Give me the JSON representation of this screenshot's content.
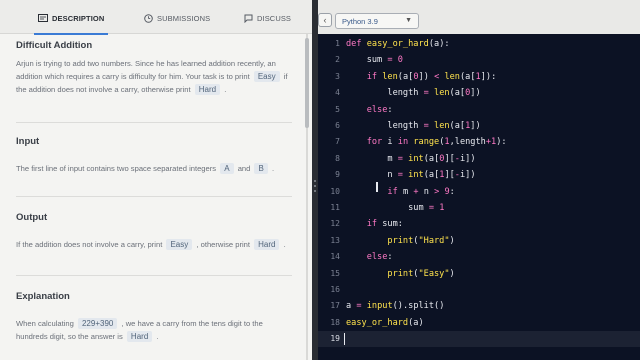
{
  "tabs": {
    "description": "DESCRIPTION",
    "submissions": "SUBMISSIONS",
    "discuss": "DISCUSS"
  },
  "language": {
    "selected": "Python 3.9"
  },
  "problem": {
    "title": "Difficult Addition",
    "intro_1": "Arjun is trying to add two numbers. Since he has learned addition recently, an addition which requires a carry is difficulty for him. Your task is to print",
    "intro_easy": "Easy",
    "intro_2": "if the addition does not involve a carry, otherwise print",
    "intro_hard": "Hard",
    "intro_end": ".",
    "input_title": "Input",
    "input_1": "The first line of input contains two space separated integers",
    "input_a": "A",
    "input_and": "and",
    "input_b": "B",
    "input_end": ".",
    "output_title": "Output",
    "output_1": "If the addition does not involve a carry, print",
    "output_easy": "Easy",
    "output_2": ", otherwise print",
    "output_hard": "Hard",
    "output_end": ".",
    "explanation_title": "Explanation",
    "expl_1": "When calculating",
    "expl_expr": "229+390",
    "expl_2": ", we have a carry from the tens digit to the hundreds digit, so the answer is",
    "expl_hard": "Hard",
    "expl_end": "."
  },
  "code_lines": [
    "def easy_or_hard(a):",
    "    sum = 0",
    "    if len(a[0]) < len(a[1]):",
    "        length = len(a[0])",
    "    else:",
    "        length = len(a[1])",
    "    for i in range(1,length+1):",
    "        m = int(a[0][-i])",
    "        n = int(a[1][-i])",
    "        if m + n > 9:",
    "            sum = 1",
    "    if sum:",
    "        print(\"Hard\")",
    "    else:",
    "        print(\"Easy\")",
    "",
    "a = input().split()",
    "easy_or_hard(a)",
    ""
  ],
  "line_numbers": [
    "1",
    "2",
    "3",
    "4",
    "5",
    "6",
    "7",
    "8",
    "9",
    "10",
    "11",
    "12",
    "13",
    "14",
    "15",
    "16",
    "17",
    "18",
    "19"
  ],
  "fold_markers": [
    "",
    "",
    "",
    "",
    "",
    "",
    "",
    "",
    "",
    "",
    "",
    "",
    "",
    "",
    "",
    "",
    "",
    "",
    ""
  ],
  "current_line": "19",
  "colors": {
    "editor_bg": "#0c1224",
    "keyword": "#ff79c6",
    "string": "#ffe34d",
    "accent": "#3a7bd5"
  },
  "icons": {
    "description": "description-icon",
    "submissions": "clock-icon",
    "discuss": "chat-icon",
    "collapse": "chevron-left-icon",
    "dropdown": "chevron-down-icon"
  }
}
